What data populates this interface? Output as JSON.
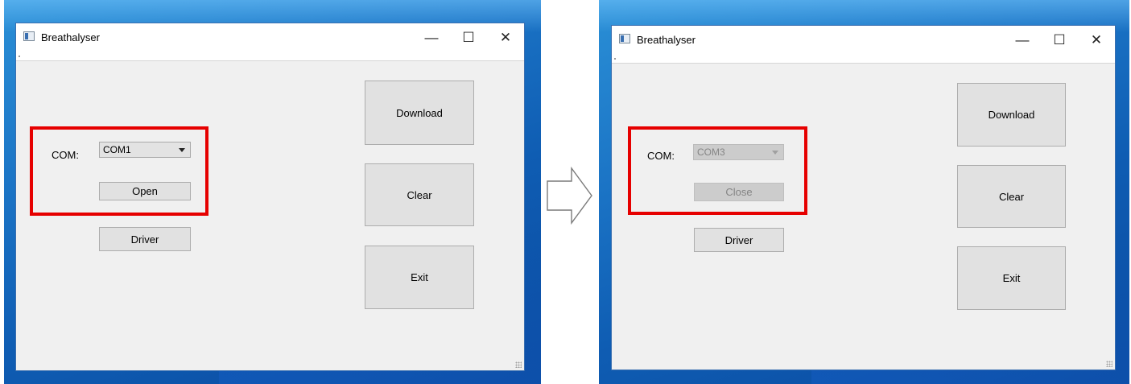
{
  "window_title": "Breathalyser",
  "title_controls": {
    "minimize": "—",
    "maximize": "☐",
    "close": "✕"
  },
  "before": {
    "com_label": "COM:",
    "com_value": "COM1",
    "open_label": "Open",
    "driver_label": "Driver",
    "download_label": "Download",
    "clear_label": "Clear",
    "exit_label": "Exit"
  },
  "after": {
    "com_label": "COM:",
    "com_value": "COM3",
    "close_label": "Close",
    "driver_label": "Driver",
    "download_label": "Download",
    "clear_label": "Clear",
    "exit_label": "Exit"
  },
  "colors": {
    "highlight": "#e60000",
    "window_bg": "#f0f0f0",
    "desktop_blue": "#1a72c4"
  },
  "icons": {
    "transition": "right-arrow-icon",
    "app": "app-window-icon"
  }
}
